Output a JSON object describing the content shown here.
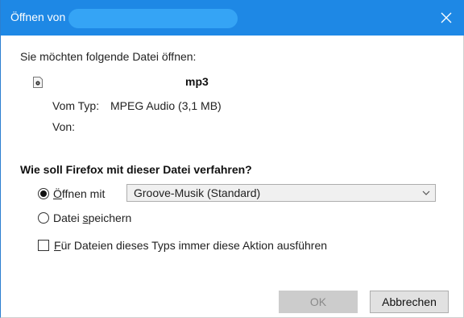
{
  "window": {
    "title": "Öffnen von",
    "close_icon": "close-icon",
    "titlebar_color": "#1e88e5"
  },
  "file": {
    "intro": "Sie möchten folgende Datei öffnen:",
    "icon": "audio-file-icon",
    "name_suffix": "mp3",
    "type_label": "Vom Typ:",
    "type_value": "MPEG Audio (3,1 MB)",
    "from_label": "Von:"
  },
  "action": {
    "question": "Wie soll Firefox mit dieser Datei verfahren?",
    "open_with": {
      "label_mnemonic": "Ö",
      "label_rest": "ffnen mit",
      "selected": true,
      "app": "Groove-Musik (Standard)"
    },
    "save_file": {
      "label_prefix": "Datei ",
      "label_mnemonic": "s",
      "label_rest": "peichern",
      "selected": false
    },
    "remember": {
      "label_mnemonic": "F",
      "label_rest": "ür Dateien dieses Typs immer diese Aktion ausführen",
      "checked": false
    }
  },
  "buttons": {
    "ok": "OK",
    "cancel": "Abbrechen"
  }
}
